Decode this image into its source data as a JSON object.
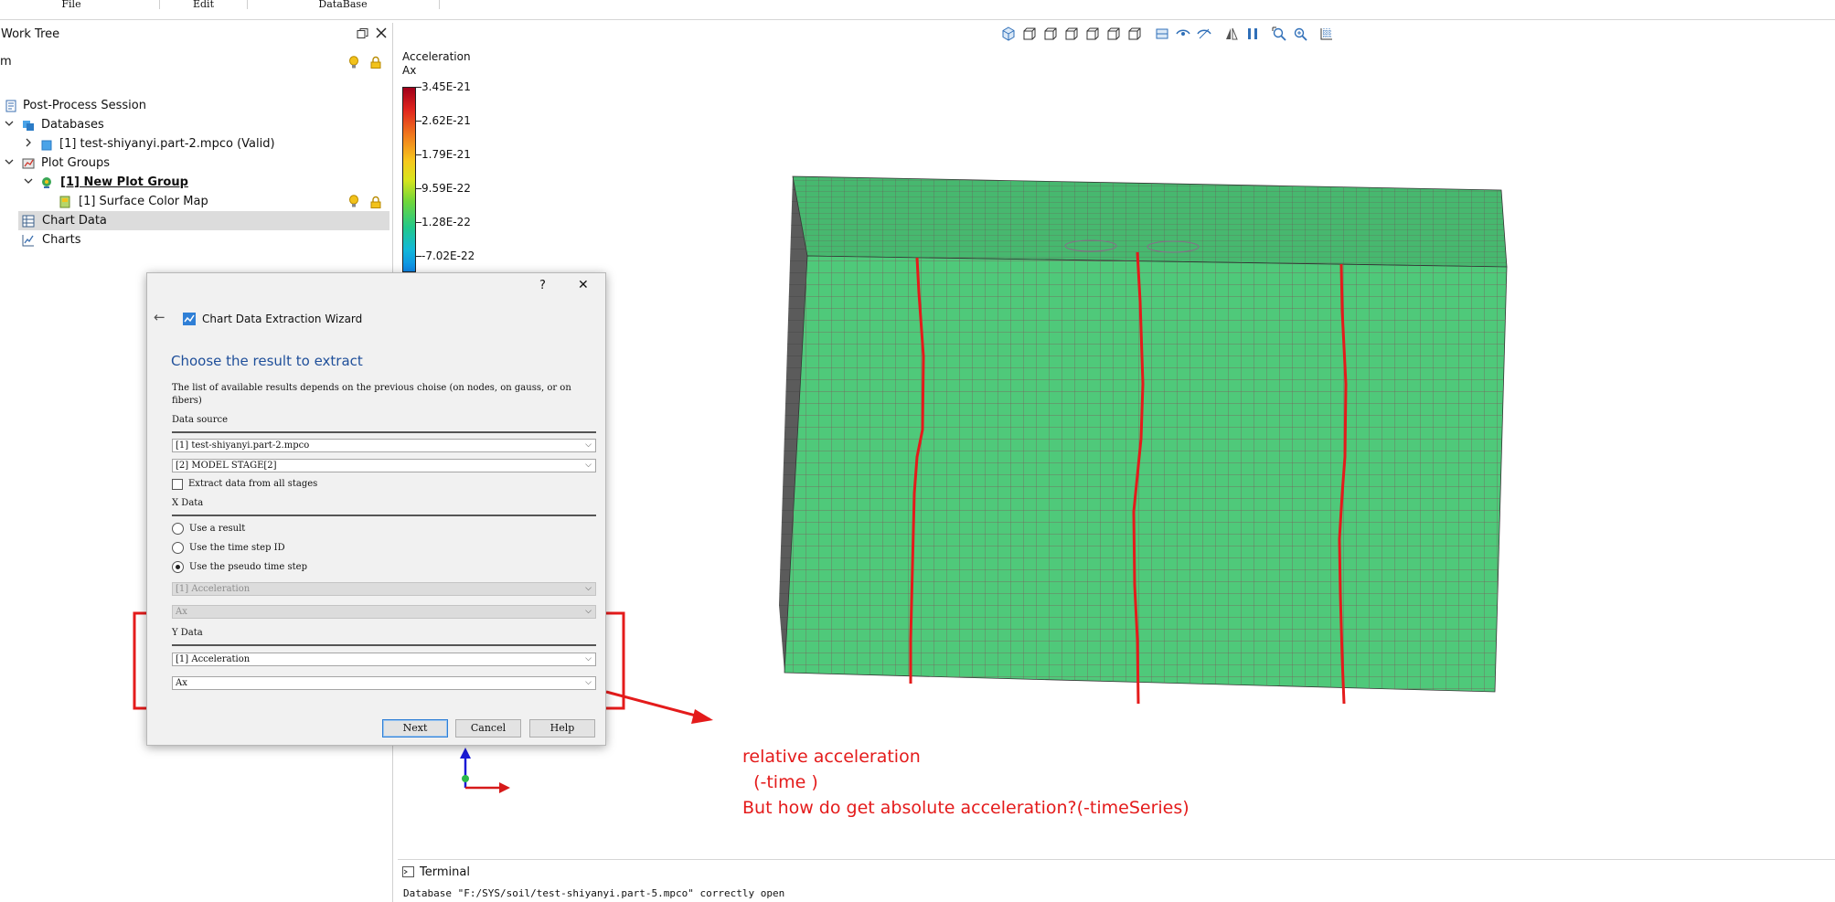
{
  "menu": {
    "file": "File",
    "edit": "Edit",
    "database": "DataBase"
  },
  "work_tree": {
    "title": "Work Tree",
    "filter_text": "m",
    "items": {
      "session": "Post-Process Session",
      "databases": "Databases",
      "db_item": "[1] test-shiyanyi.part-2.mpco (Valid)",
      "plot_groups": "Plot Groups",
      "plot_group": "[1] New Plot Group",
      "surface_map": "[1] Surface Color Map",
      "chart_data": "Chart Data",
      "charts": "Charts"
    }
  },
  "legend": {
    "title_line1": "Acceleration",
    "title_line2": "Ax",
    "labels": [
      "3.45E-21",
      "2.62E-21",
      "1.79E-21",
      "9.59E-22",
      "1.28E-22",
      "-7.02E-22"
    ]
  },
  "wizard": {
    "help_glyph": "?",
    "close_glyph": "✕",
    "back_glyph": "←",
    "title": "Chart Data Extraction Wizard",
    "heading": "Choose the result to extract",
    "description": "The list of available results depends on the previous choise (on nodes, on gauss, or on fibers)",
    "data_source_label": "Data source",
    "source_value": "[1] test-shiyanyi.part-2.mpco",
    "stage_value": "[2] MODEL STAGE[2]",
    "extract_all_label": "Extract data from all stages",
    "x_data_label": "X Data",
    "x_options": [
      "Use a result",
      "Use the time step ID",
      "Use the pseudo time step"
    ],
    "x_result_value": "[1] Acceleration",
    "x_comp_value": "Ax",
    "y_data_label": "Y Data",
    "y_result_value": "[1] Acceleration",
    "y_comp_value": "Ax",
    "buttons": {
      "next": "Next",
      "cancel": "Cancel",
      "help": "Help"
    }
  },
  "annotation": {
    "line1": "relative acceleration",
    "line2": "  (-time )",
    "line3": "But how do get absolute acceleration?(-timeSeries)",
    "color": "#e41b1b"
  },
  "terminal": {
    "title": "Terminal",
    "message": "Database \"F:/SYS/soil/test-shiyanyi.part-5.mpco\" correctly open"
  },
  "colors": {
    "mesh_fill": "#4fc97a",
    "mesh_top": "#47b86f",
    "mesh_side": "#5b5b5b",
    "accent": "#2f7fd6",
    "dialog_heading": "#1f4f9a"
  }
}
